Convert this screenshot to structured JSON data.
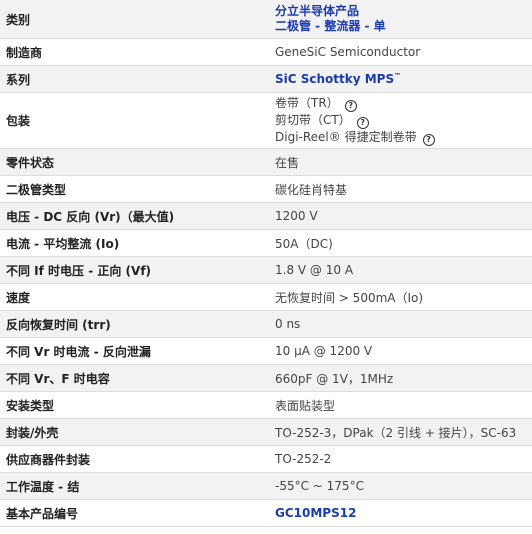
{
  "header": {
    "label": "类别",
    "links": [
      "分立半导体产品",
      "二极管 - 整流器 - 单"
    ]
  },
  "manufacturer": {
    "label": "制造商",
    "value": "GeneSiC Semiconductor"
  },
  "series": {
    "label": "系列",
    "value": "SiC Schottky MPS",
    "tm": "™"
  },
  "packaging": {
    "label": "包装",
    "items": [
      "卷带（TR）",
      "剪切带（CT）",
      "Digi-Reel® 得捷定制卷带"
    ],
    "help_glyph": "?"
  },
  "rows": [
    {
      "label": "零件状态",
      "value": "在售"
    },
    {
      "label": "二极管类型",
      "value": "碳化硅肖特基"
    },
    {
      "label": "电压 - DC 反向 (Vr)（最大值)",
      "value": "1200 V"
    },
    {
      "label": "电流 - 平均整流 (Io)",
      "value": "50A（DC)"
    },
    {
      "label": "不同 If 时电压 - 正向 (Vf)",
      "value": "1.8 V @ 10 A"
    },
    {
      "label": "速度",
      "value": "无恢复时间 > 500mA（Io)"
    },
    {
      "label": "反向恢复时间 (trr)",
      "value": "0 ns"
    },
    {
      "label": "不同 Vr 时电流 - 反向泄漏",
      "value": "10 µA @ 1200 V"
    },
    {
      "label": "不同 Vr、F 时电容",
      "value": "660pF @ 1V，1MHz"
    },
    {
      "label": "安装类型",
      "value": "表面贴装型"
    },
    {
      "label": "封装/外壳",
      "value": "TO-252-3，DPak（2 引线 + 接片），SC-63"
    },
    {
      "label": "供应商器件封装",
      "value": "TO-252-2"
    },
    {
      "label": "工作温度 - 结",
      "value": "-55°C ~ 175°C"
    }
  ],
  "base_part": {
    "label": "基本产品编号",
    "value": "GC10MPS12"
  }
}
